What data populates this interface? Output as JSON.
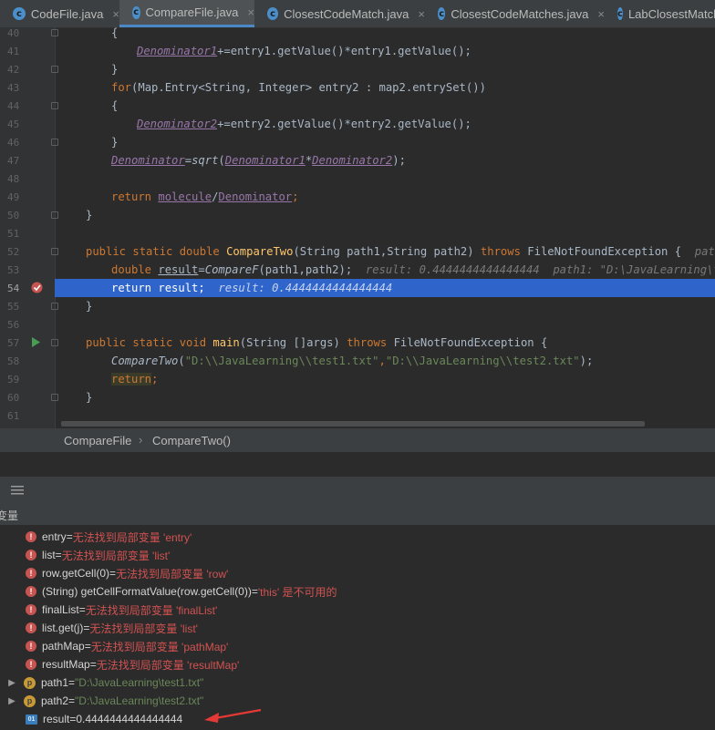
{
  "tabs": [
    {
      "label": "CodeFile.java",
      "icon": "c-class-icon"
    },
    {
      "label": "CompareFile.java",
      "icon": "c-class-icon"
    },
    {
      "label": "ClosestCodeMatch.java",
      "icon": "c-class-icon"
    },
    {
      "label": "ClosestCodeMatches.java",
      "icon": "c-class-icon"
    },
    {
      "label": "LabClosestMatch",
      "icon": "c-class-icon"
    }
  ],
  "active_tab": "CompareFile.java",
  "line_numbers": [
    "40",
    "41",
    "42",
    "43",
    "44",
    "45",
    "46",
    "47",
    "48",
    "49",
    "50",
    "51",
    "52",
    "53",
    "54",
    "55",
    "56",
    "57",
    "58",
    "59",
    "60",
    "61"
  ],
  "code": {
    "l40": "{",
    "l41_a": "Denominator1",
    "l41_b": "+=entry1.getValue()*entry1.getValue();",
    "l42": "}",
    "l43_kw": "for",
    "l43_rest": "(Map.Entry<String, Integer> entry2 : map2.entrySet())",
    "l44": "{",
    "l45_a": "Denominator2",
    "l45_b": "+=entry2.getValue()*entry2.getValue();",
    "l46": "}",
    "l47_a": "Denominator",
    "l47_b": "=",
    "l47_c": "sqrt",
    "l47_d": "(",
    "l47_e": "Denominator1",
    "l47_f": "*",
    "l47_g": "Denominator2",
    "l47_h": ");",
    "l49_kw": "return ",
    "l49_a": "molecule",
    "l49_b": "/",
    "l49_c": "Denominator",
    "l49_d": ";",
    "l50": "}",
    "l52_kw": "public static double ",
    "l52_fn": "CompareTwo",
    "l52_args": "(String path1,String path2) ",
    "l52_kw2": "throws ",
    "l52_ex": "FileNotFoundException {",
    "l52_hint": "path1: \"",
    "l53_kw": "double ",
    "l53_var": "result",
    "l53_eq": "=",
    "l53_fn": "CompareF",
    "l53_args": "(path1,path2);",
    "l53_hint": "result: 0.4444444444444444  path1: \"D:\\JavaLearning\\test1",
    "l54_code": "return result;",
    "l54_hint": "result: 0.4444444444444444",
    "l55": "}",
    "l57_kw": "public static void ",
    "l57_fn": "main",
    "l57_args": "(String []args) ",
    "l57_kw2": "throws ",
    "l57_ex": "FileNotFoundException {",
    "l58_fn": "CompareTwo",
    "l58_p": "(",
    "l58_s1": "\"D:\\\\JavaLearning\\\\test1.txt\"",
    "l58_c": ",",
    "l58_s2": "\"D:\\\\JavaLearning\\\\test2.txt\"",
    "l58_e": ");",
    "l59_kw": "return",
    "l59_e": ";",
    "l60": "}"
  },
  "breadcrumb": {
    "item1": "CompareFile",
    "sep": "›",
    "item2": "CompareTwo()"
  },
  "debug_toolbar": {
    "icon": "layout-lines-icon"
  },
  "variables_header": "变量",
  "variables": [
    {
      "name": "entry",
      "eq": " = ",
      "value": "无法找到局部变量 'entry'",
      "kind": "error"
    },
    {
      "name": "list",
      "eq": " = ",
      "value": "无法找到局部变量 'list'",
      "kind": "error"
    },
    {
      "name": "row.getCell(0)",
      "eq": " = ",
      "value": "无法找到局部变量 'row'",
      "kind": "error"
    },
    {
      "name": "(String) getCellFormatValue(row.getCell(0))",
      "eq": " = ",
      "value": "'this' 是不可用的",
      "kind": "error"
    },
    {
      "name": "finalList",
      "eq": " = ",
      "value": "无法找到局部变量 'finalList'",
      "kind": "error"
    },
    {
      "name": "list.get(j)",
      "eq": " = ",
      "value": "无法找到局部变量 'list'",
      "kind": "error"
    },
    {
      "name": "pathMap",
      "eq": " = ",
      "value": "无法找到局部变量 'pathMap'",
      "kind": "error"
    },
    {
      "name": "resultMap",
      "eq": " = ",
      "value": "无法找到局部变量 'resultMap'",
      "kind": "error"
    },
    {
      "name": "path1",
      "eq": " = ",
      "value": "\"D:\\JavaLearning\\test1.txt\"",
      "kind": "param"
    },
    {
      "name": "path2",
      "eq": " = ",
      "value": "\"D:\\JavaLearning\\test2.txt\"",
      "kind": "param"
    },
    {
      "name": "result",
      "eq": " = ",
      "value": "0.4444444444444444",
      "kind": "number"
    }
  ],
  "icons": {
    "error": "!",
    "param": "p",
    "number": "01",
    "class": "c"
  },
  "colors": {
    "selection": "#2f65ca",
    "annotation_arrow": "#e53935",
    "error": "#d25252"
  }
}
